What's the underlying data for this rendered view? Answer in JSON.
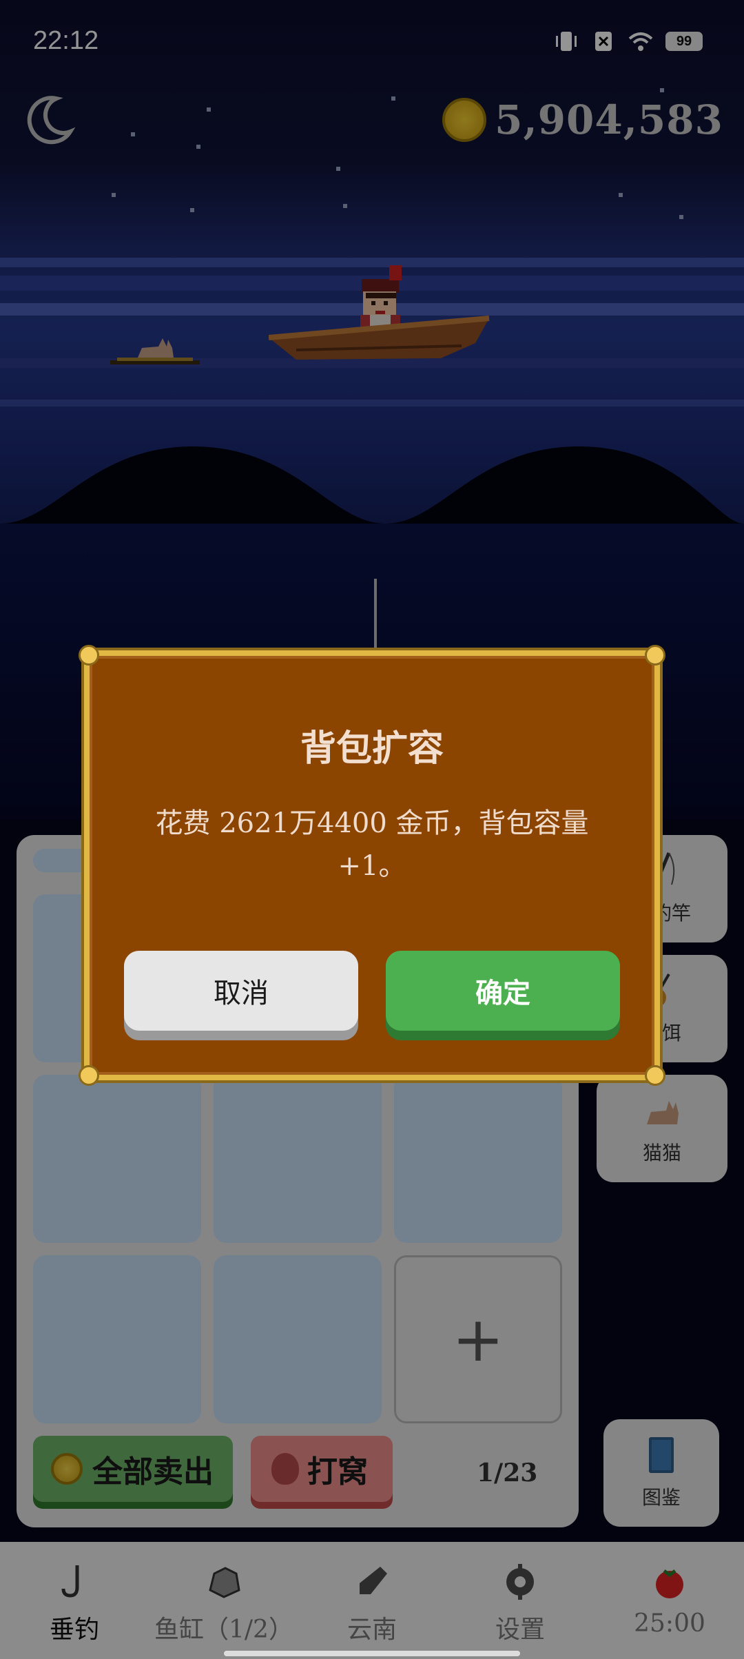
{
  "status_bar": {
    "time": "22:12",
    "battery": "99"
  },
  "header": {
    "coins": "5,904,583"
  },
  "inventory": {
    "sell_all_label": "全部卖出",
    "nest_label": "打窝",
    "capacity": "1/23",
    "add_label": "+"
  },
  "side_buttons": [
    {
      "label": "制钓竿",
      "icon": "fishing-rod-icon"
    },
    {
      "label": "鱼饵",
      "icon": "bait-icon"
    },
    {
      "label": "猫猫",
      "icon": "cat-icon"
    },
    {
      "label": "图鉴",
      "icon": "book-icon"
    }
  ],
  "dialog": {
    "title": "背包扩容",
    "message": "花费 2621万4400 金币，背包容量+1。",
    "cancel_label": "取消",
    "confirm_label": "确定"
  },
  "nav": [
    {
      "label": "垂钓",
      "icon": "hook-icon",
      "active": true
    },
    {
      "label": "鱼缸（1/2）",
      "icon": "rock-icon",
      "active": false
    },
    {
      "label": "云南",
      "icon": "bottle-icon",
      "active": false
    },
    {
      "label": "设置",
      "icon": "gear-icon",
      "active": false
    },
    {
      "label": "25:00",
      "icon": "tomato-icon",
      "active": false
    }
  ],
  "colors": {
    "dialog_bg": "#8b4500",
    "dialog_border": "#e2b844",
    "confirm": "#4cb050",
    "cancel": "#e6e6e6"
  }
}
